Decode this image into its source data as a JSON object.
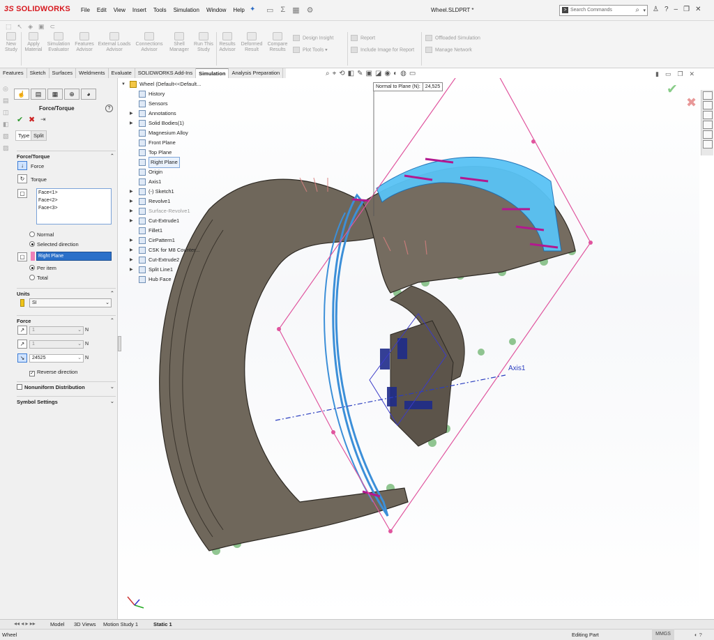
{
  "app": {
    "logo": "SOLIDWORKS",
    "menu": [
      "File",
      "Edit",
      "View",
      "Insert",
      "Tools",
      "Simulation",
      "Window",
      "Help"
    ],
    "doc_title": "Wheel.SLDPRT *",
    "search_placeholder": "Search Commands"
  },
  "ribbon": {
    "buttons": [
      {
        "l1": "New",
        "l2": "Study"
      },
      {
        "l1": "Apply",
        "l2": "Material"
      },
      {
        "l1": "Simulation",
        "l2": "Evaluator"
      },
      {
        "l1": "Features",
        "l2": "Advisor"
      },
      {
        "l1": "External Loads",
        "l2": "Advisor"
      },
      {
        "l1": "Connections",
        "l2": "Advisor"
      },
      {
        "l1": "Shell",
        "l2": "Manager"
      },
      {
        "l1": "Run This",
        "l2": "Study"
      },
      {
        "l1": "Results",
        "l2": "Advisor"
      },
      {
        "l1": "Deformed",
        "l2": "Result"
      },
      {
        "l1": "Compare",
        "l2": "Results"
      }
    ],
    "side": {
      "design_insight": "Design Insight",
      "plot_tools": "Plot Tools",
      "report": "Report",
      "include_image": "Include Image for Report",
      "offloaded": "Offloaded Simulation",
      "manage_network": "Manage Network"
    }
  },
  "tabs": [
    "Features",
    "Sketch",
    "Surfaces",
    "Weldments",
    "Evaluate",
    "SOLIDWORKS Add-Ins",
    "Simulation",
    "Analysis Preparation"
  ],
  "active_tab": "Simulation",
  "property_manager": {
    "title": "Force/Torque",
    "subtabs": [
      "Type",
      "Split"
    ],
    "group_force_torque": "Force/Torque",
    "force_label": "Force",
    "torque_label": "Torque",
    "faces": [
      "Face<1>",
      "Face<2>",
      "Face<3>"
    ],
    "normal_label": "Normal",
    "selected_direction_label": "Selected direction",
    "direction_reference": "Right Plane",
    "per_item_label": "Per item",
    "total_label": "Total",
    "group_units": "Units",
    "unit_system": "SI",
    "group_force": "Force",
    "force_values": [
      "1",
      "1",
      "24525"
    ],
    "force_unit": "N",
    "reverse_direction_label": "Reverse direction",
    "nonuniform_label": "Nonuniform Distribution",
    "symbol_settings_label": "Symbol Settings"
  },
  "tree": {
    "root": "Wheel  (Default<<Default...",
    "items": [
      {
        "label": "History",
        "exp": false,
        "dim": false,
        "sel": false
      },
      {
        "label": "Sensors",
        "exp": false,
        "dim": false,
        "sel": false
      },
      {
        "label": "Annotations",
        "exp": true,
        "dim": false,
        "sel": false
      },
      {
        "label": "Solid Bodies(1)",
        "exp": true,
        "dim": false,
        "sel": false
      },
      {
        "label": "Magnesium Alloy",
        "exp": false,
        "dim": false,
        "sel": false
      },
      {
        "label": "Front Plane",
        "exp": false,
        "dim": false,
        "sel": false
      },
      {
        "label": "Top Plane",
        "exp": false,
        "dim": false,
        "sel": false
      },
      {
        "label": "Right Plane",
        "exp": false,
        "dim": false,
        "sel": true
      },
      {
        "label": "Origin",
        "exp": false,
        "dim": false,
        "sel": false
      },
      {
        "label": "Axis1",
        "exp": false,
        "dim": false,
        "sel": false
      },
      {
        "label": "(-) Sketch1",
        "exp": true,
        "dim": false,
        "sel": false
      },
      {
        "label": "Revolve1",
        "exp": true,
        "dim": false,
        "sel": false
      },
      {
        "label": "Surface-Revolve1",
        "exp": true,
        "dim": true,
        "sel": false
      },
      {
        "label": "Cut-Extrude1",
        "exp": true,
        "dim": false,
        "sel": false
      },
      {
        "label": "Fillet1",
        "exp": false,
        "dim": false,
        "sel": false
      },
      {
        "label": "CirPattern1",
        "exp": true,
        "dim": false,
        "sel": false
      },
      {
        "label": "CSK for M8 Counter...",
        "exp": true,
        "dim": false,
        "sel": false
      },
      {
        "label": "Cut-Extrude2",
        "exp": true,
        "dim": false,
        "sel": false
      },
      {
        "label": "Split Line1",
        "exp": true,
        "dim": false,
        "sel": false
      },
      {
        "label": "Hub Face",
        "exp": false,
        "dim": false,
        "sel": false
      }
    ]
  },
  "viewport": {
    "tooltip_label": "Normal to Plane (N):",
    "tooltip_value": "24,525",
    "axis_label": "Axis1"
  },
  "bottom_tabs": [
    "Model",
    "3D Views",
    "Motion Study 1",
    "Static 1"
  ],
  "status": {
    "left": "Wheel",
    "mode": "Editing Part",
    "units": "MMGS"
  },
  "colors": {
    "accent": "#2b70c9",
    "logo": "#d7191f",
    "part": "#6f675b",
    "selected_face": "#59c3f5",
    "force_arrow": "#b3188f",
    "plane": "#e0559e",
    "fixture": "#38a83a"
  }
}
